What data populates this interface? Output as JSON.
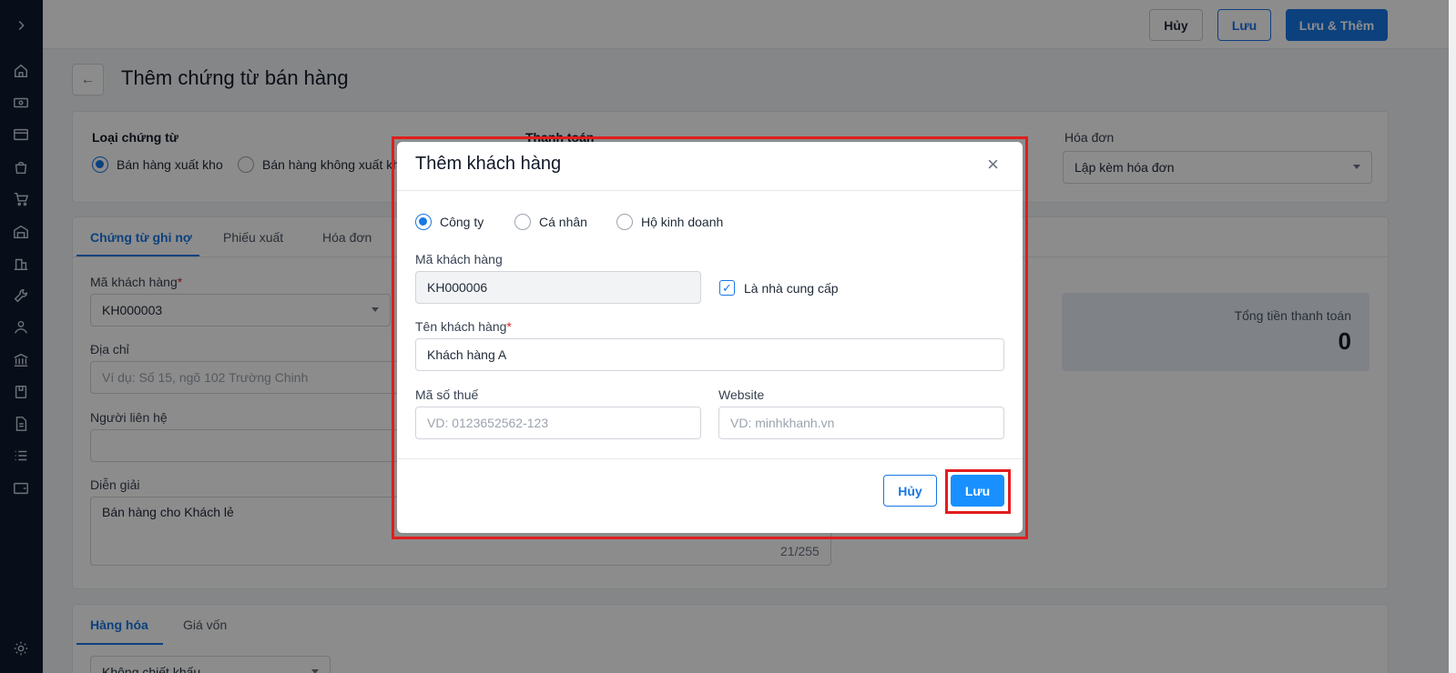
{
  "topbar": {
    "cancel": "Hủy",
    "save": "Lưu",
    "save_add": "Lưu & Thêm"
  },
  "page": {
    "title": "Thêm chứng từ bán hàng"
  },
  "voucher": {
    "type_label": "Loại chứng từ",
    "type_options": [
      "Bán hàng xuất kho",
      "Bán hàng không xuất kh"
    ],
    "payment_label": "Thanh toán",
    "invoice_label": "Hóa đơn",
    "invoice_value": "Lập kèm hóa đơn"
  },
  "tabs": [
    "Chứng từ ghi nợ",
    "Phiếu xuất",
    "Hóa đơn"
  ],
  "form": {
    "customer_code_label": "Mã khách hàng",
    "customer_code_value": "KH000003",
    "address_label": "Địa chỉ",
    "address_placeholder": "Ví dụ: Số 15, ngõ 102 Trường Chinh",
    "contact_label": "Người liên hệ",
    "description_label": "Diễn giải",
    "description_value": "Bán hàng cho Khách lẻ",
    "description_count": "21/255",
    "total_label": "Tổng tiền thanh toán",
    "total_value": "0"
  },
  "goods_tabs": [
    "Hàng hóa",
    "Giá vốn"
  ],
  "discount_value": "Không chiết khấu",
  "modal": {
    "title": "Thêm khách hàng",
    "close": "×",
    "types": [
      "Công ty",
      "Cá nhân",
      "Hộ kinh doanh"
    ],
    "code_label": "Mã khách hàng",
    "code_value": "KH000006",
    "supplier_label": "Là nhà cung cấp",
    "name_label": "Tên khách hàng",
    "name_value": "Khách hàng A",
    "tax_label": "Mã số thuế",
    "tax_placeholder": "VD: 0123652562-123",
    "website_label": "Website",
    "website_placeholder": "VD: minhkhanh.vn",
    "cancel": "Hủy",
    "save": "Lưu"
  },
  "colors": {
    "accent": "#1677e6",
    "highlight": "#e11d1d",
    "sidebar": "#0f1a2e"
  }
}
